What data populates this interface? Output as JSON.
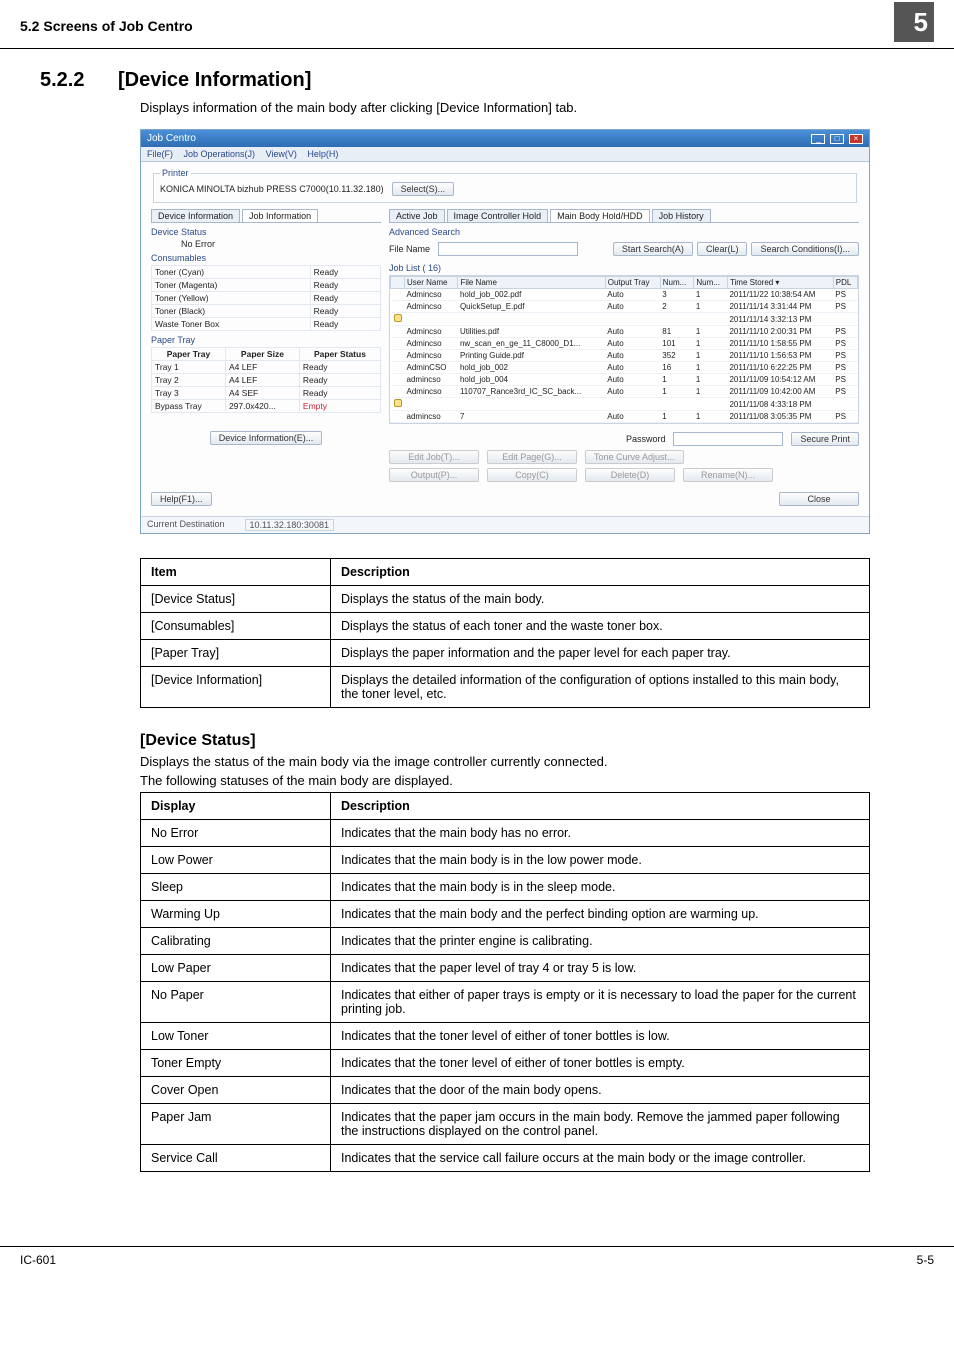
{
  "page": {
    "header_left": "5.2    Screens of Job Centro",
    "header_right": "5",
    "section_num": "5.2.2",
    "section_title": "[Device Information]",
    "intro": "Displays information of the main body after clicking [Device Information] tab.",
    "subheading": "[Device Status]",
    "para1": "Displays the status of the main body via the image controller currently connected.",
    "para2": "The following statuses of the main body are displayed.",
    "footer_left": "IC-601",
    "footer_right": "5-5"
  },
  "screenshot": {
    "window_title": "Job Centro",
    "menus": [
      "File(F)",
      "Job Operations(J)",
      "View(V)",
      "Help(H)"
    ],
    "printer_legend": "Printer",
    "printer_name": "KONICA MINOLTA bizhub PRESS C7000(10.11.32.180)",
    "select_btn": "Select(S)...",
    "left_tabs": [
      "Device Information",
      "Job Information"
    ],
    "active_left_tab": "Job Information",
    "device_status": {
      "title": "Device Status",
      "value": "No Error"
    },
    "consumables": {
      "title": "Consumables",
      "rows": [
        [
          "Toner (Cyan)",
          "Ready"
        ],
        [
          "Toner (Magenta)",
          "Ready"
        ],
        [
          "Toner (Yellow)",
          "Ready"
        ],
        [
          "Toner (Black)",
          "Ready"
        ],
        [
          "Waste Toner Box",
          "Ready"
        ]
      ]
    },
    "paper_tray": {
      "title": "Paper Tray",
      "headers": [
        "Paper Tray",
        "Paper Size",
        "Paper Status"
      ],
      "rows": [
        [
          "Tray 1",
          "A4 LEF",
          "Ready"
        ],
        [
          "Tray 2",
          "A4 LEF",
          "Ready"
        ],
        [
          "Tray 3",
          "A4 SEF",
          "Ready"
        ],
        [
          "Bypass Tray",
          "297.0x420...",
          "Empty"
        ]
      ]
    },
    "device_info_btn": "Device Information(E)...",
    "right_tabs": [
      "Active Job",
      "Image Controller Hold",
      "Main Body Hold/HDD",
      "Job History"
    ],
    "active_right_tab": "Main Body Hold/HDD",
    "adv_search": "Advanced Search",
    "file_name_label": "File Name",
    "start_search_btn": "Start Search(A)",
    "clear_btn": "Clear(L)",
    "search_cond_btn": "Search Conditions(I)...",
    "job_list_label": "Job List ( 16)",
    "job_headers": [
      "",
      "User Name",
      "File Name",
      "Output Tray",
      "Num...",
      "Num...",
      "Time Stored ▾",
      "PDL"
    ],
    "jobs": [
      {
        "lock": false,
        "user": "Admincso",
        "file": "hold_job_002.pdf",
        "tray": "Auto",
        "n1": "3",
        "n2": "1",
        "time": "2011/11/22 10:38:54 AM",
        "pdl": "PS"
      },
      {
        "lock": false,
        "user": "Admincso",
        "file": "QuickSetup_E.pdf",
        "tray": "Auto",
        "n1": "2",
        "n2": "1",
        "time": "2011/11/14 3:31:44 PM",
        "pdl": "PS"
      },
      {
        "lock": true,
        "user": "",
        "file": "",
        "tray": "",
        "n1": "",
        "n2": "",
        "time": "2011/11/14 3:32:13 PM",
        "pdl": ""
      },
      {
        "lock": false,
        "user": "Admincso",
        "file": "Utilities.pdf",
        "tray": "Auto",
        "n1": "81",
        "n2": "1",
        "time": "2011/11/10 2:00:31 PM",
        "pdl": "PS"
      },
      {
        "lock": false,
        "user": "Admincso",
        "file": "nw_scan_en_ge_11_C8000_D1...",
        "tray": "Auto",
        "n1": "101",
        "n2": "1",
        "time": "2011/11/10 1:58:55 PM",
        "pdl": "PS"
      },
      {
        "lock": false,
        "user": "Admincso",
        "file": "Printing Guide.pdf",
        "tray": "Auto",
        "n1": "352",
        "n2": "1",
        "time": "2011/11/10 1:56:53 PM",
        "pdl": "PS"
      },
      {
        "lock": false,
        "user": "AdminCSO",
        "file": "hold_job_002",
        "tray": "Auto",
        "n1": "16",
        "n2": "1",
        "time": "2011/11/10 6:22:25 PM",
        "pdl": "PS"
      },
      {
        "lock": false,
        "user": "admincso",
        "file": "hold_job_004",
        "tray": "Auto",
        "n1": "1",
        "n2": "1",
        "time": "2011/11/09 10:54:12 AM",
        "pdl": "PS"
      },
      {
        "lock": false,
        "user": "Admincso",
        "file": "110707_Rance3rd_IC_SC_back...",
        "tray": "Auto",
        "n1": "1",
        "n2": "1",
        "time": "2011/11/09 10:42:00 AM",
        "pdl": "PS"
      },
      {
        "lock": true,
        "user": "",
        "file": "",
        "tray": "",
        "n1": "",
        "n2": "",
        "time": "2011/11/08 4:33:18 PM",
        "pdl": ""
      },
      {
        "lock": false,
        "user": "admincso",
        "file": "7",
        "tray": "Auto",
        "n1": "1",
        "n2": "1",
        "time": "2011/11/08 3:05:35 PM",
        "pdl": "PS"
      }
    ],
    "password_label": "Password",
    "secure_print_btn": "Secure Print",
    "action_btns": {
      "edit_job": "Edit Job(T)...",
      "edit_page": "Edit Page(G)...",
      "tone_curve": "Tone Curve Adjust...",
      "output": "Output(P)...",
      "copy": "Copy(C)",
      "delete": "Delete(D)",
      "rename": "Rename(N)..."
    },
    "help_btn": "Help(F1)...",
    "close_btn": "Close",
    "status_label": "Current Destination",
    "status_value": "10.11.32.180:30081"
  },
  "items_table": {
    "headers": [
      "Item",
      "Description"
    ],
    "rows": [
      [
        "[Device Status]",
        "Displays the status of the main body."
      ],
      [
        "[Consumables]",
        "Displays the status of each toner and the waste toner box."
      ],
      [
        "[Paper Tray]",
        "Displays the paper information and the paper level for each paper tray."
      ],
      [
        "[Device Information]",
        "Displays the detailed information of the configuration of options installed to this main body, the toner level, etc."
      ]
    ]
  },
  "status_table": {
    "headers": [
      "Display",
      "Description"
    ],
    "rows": [
      [
        "No Error",
        "Indicates that the main body has no error."
      ],
      [
        "Low Power",
        "Indicates that the main body is in the low power mode."
      ],
      [
        "Sleep",
        "Indicates that the main body is in the sleep mode."
      ],
      [
        "Warming Up",
        "Indicates that the main body and the perfect binding option are warming up."
      ],
      [
        "Calibrating",
        "Indicates that the printer engine is calibrating."
      ],
      [
        "Low Paper",
        "Indicates that the paper level of tray 4 or tray 5 is low."
      ],
      [
        "No Paper",
        "Indicates that either of paper trays is empty or it is necessary to load the paper for the current printing job."
      ],
      [
        "Low Toner",
        "Indicates that the toner level of either of toner bottles is low."
      ],
      [
        "Toner Empty",
        "Indicates that the toner level of either of toner bottles is empty."
      ],
      [
        "Cover Open",
        "Indicates that the door of the main body opens."
      ],
      [
        "Paper Jam",
        "Indicates that the paper jam occurs in the main body. Remove the jammed paper following the instructions displayed on the control panel."
      ],
      [
        "Service Call",
        "Indicates that the service call failure occurs at the main body or the image controller."
      ]
    ]
  }
}
